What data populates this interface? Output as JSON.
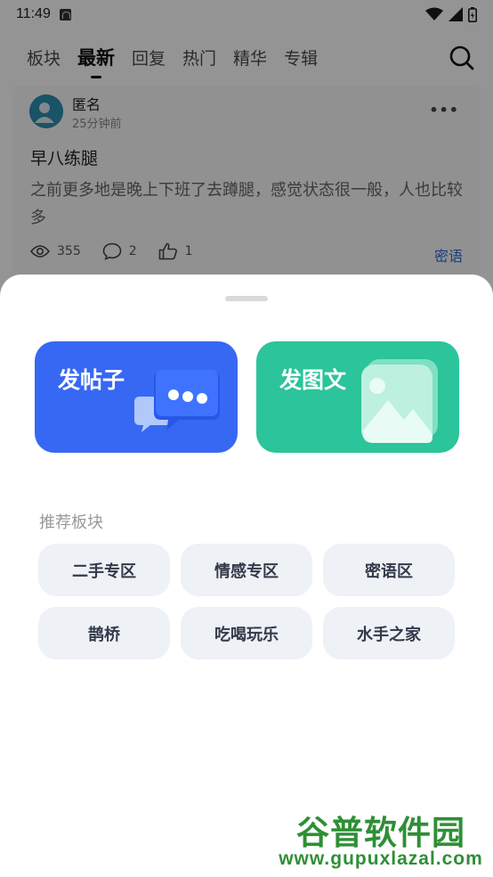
{
  "status_bar": {
    "time": "11:49"
  },
  "tabs": [
    {
      "label": "板块",
      "active": false
    },
    {
      "label": "最新",
      "active": true
    },
    {
      "label": "回复",
      "active": false
    },
    {
      "label": "热门",
      "active": false
    },
    {
      "label": "精华",
      "active": false
    },
    {
      "label": "专辑",
      "active": false
    }
  ],
  "post": {
    "author": "匿名",
    "time": "25分钟前",
    "title": "早八练腿",
    "body": "之前更多地是晚上下班了去蹲腿，感觉状态很一般，人也比较多",
    "views": "355",
    "comments": "2",
    "likes": "1",
    "board": "密语"
  },
  "sheet": {
    "actions": [
      {
        "label": "发帖子",
        "color": "#3768f3",
        "icon": "chat-bubbles-icon"
      },
      {
        "label": "发图文",
        "color": "#2cc49a",
        "icon": "image-icon"
      }
    ],
    "section_title": "推荐板块",
    "boards": [
      "二手专区",
      "情感专区",
      "密语区",
      "鹊桥",
      "吃喝玩乐",
      "水手之家"
    ]
  },
  "watermark": {
    "brand": "谷普软件园",
    "url": "www.gupuxlazal.com"
  }
}
